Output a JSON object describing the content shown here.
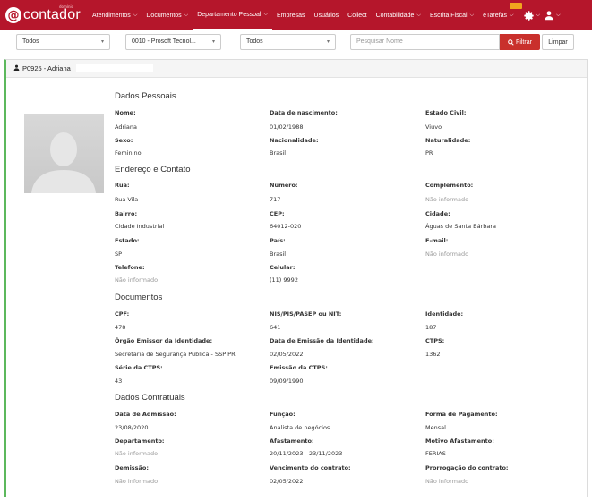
{
  "topnav": {
    "logo_text": "contador",
    "logo_small": "domínio",
    "items": [
      {
        "label": "Atendimentos",
        "dropdown": true
      },
      {
        "label": "Documentos",
        "dropdown": true
      },
      {
        "label": "Departamento Pessoal",
        "dropdown": true
      },
      {
        "label": "Empresas",
        "dropdown": false
      },
      {
        "label": "Usuários",
        "dropdown": false
      },
      {
        "label": "Collect",
        "dropdown": false
      },
      {
        "label": "Contabilidade",
        "dropdown": true
      },
      {
        "label": "Escrita Fiscal",
        "dropdown": true
      }
    ],
    "etarefas_label": "eTarefas",
    "accent_color": "#b5162b"
  },
  "filters": {
    "select1": "Todos",
    "select2": "0010 - Prosoft Tecnol...",
    "select3": "Todos",
    "search_placeholder": "Pesquisar Nome",
    "filter_button": "Filtrar",
    "clear_button": "Limpar"
  },
  "card": {
    "header": "P0925 - Adriana",
    "sections": {
      "personal": "Dados Pessoais",
      "address": "Endereço e Contato",
      "documents": "Documentos",
      "contract": "Dados Contratuais"
    },
    "fields": {
      "nome_label": "Nome:",
      "nome": "Adriana",
      "nasc_label": "Data de nascimento:",
      "nasc": "01/02/1988",
      "civil_label": "Estado Civil:",
      "civil": "Viuvo",
      "sexo_label": "Sexo:",
      "sexo": "Feminino",
      "nac_label": "Nacionalidade:",
      "nac": "Brasil",
      "natur_label": "Naturalidade:",
      "natur": "PR",
      "rua_label": "Rua:",
      "rua": "Rua Vila",
      "num_label": "Número:",
      "num": "717",
      "compl_label": "Complemento:",
      "compl": "Não informado",
      "bairro_label": "Bairro:",
      "bairro": "Cidade Industrial",
      "cep_label": "CEP:",
      "cep": "64012-020",
      "cidade_label": "Cidade:",
      "cidade": "Águas de Santa Bárbara",
      "estado_label": "Estado:",
      "estado": "SP",
      "pais_label": "País:",
      "pais": "Brasil",
      "email_label": "E-mail:",
      "email": "Não informado",
      "tel_label": "Telefone:",
      "tel": "Não informado",
      "cel_label": "Celular:",
      "cel": "(11) 9992",
      "cpf_label": "CPF:",
      "cpf": "478",
      "nis_label": "NIS/PIS/PASEP ou NIT:",
      "nis": "641",
      "ident_label": "Identidade:",
      "ident": "187",
      "orgao_label": "Órgão Emissor da Identidade:",
      "orgao": "Secretaria de Segurança Publica - SSP PR",
      "emissao_label": "Data de Emissão da Identidade:",
      "emissao": "02/05/2022",
      "ctps_label": "CTPS:",
      "ctps": "1362",
      "serie_label": "Série da CTPS:",
      "serie": "43",
      "emctps_label": "Emissão da CTPS:",
      "emctps": "09/09/1990",
      "admissao_label": "Data de Admissão:",
      "admissao": "23/08/2020",
      "funcao_label": "Função:",
      "funcao": "Analista de negócios",
      "pagto_label": "Forma de Pagamento:",
      "pagto": "Mensal",
      "depto_label": "Departamento:",
      "depto": "Não informado",
      "afast_label": "Afastamento:",
      "afast": "20/11/2023 - 23/11/2023",
      "motivo_label": "Motivo Afastamento:",
      "motivo": "FERIAS",
      "demissao_label": "Demissão:",
      "demissao": "Não informado",
      "venc_label": "Vencimento do contrato:",
      "venc": "02/05/2022",
      "prorrog_label": "Prorrogação do contrato:",
      "prorrog": "Não informado"
    }
  }
}
